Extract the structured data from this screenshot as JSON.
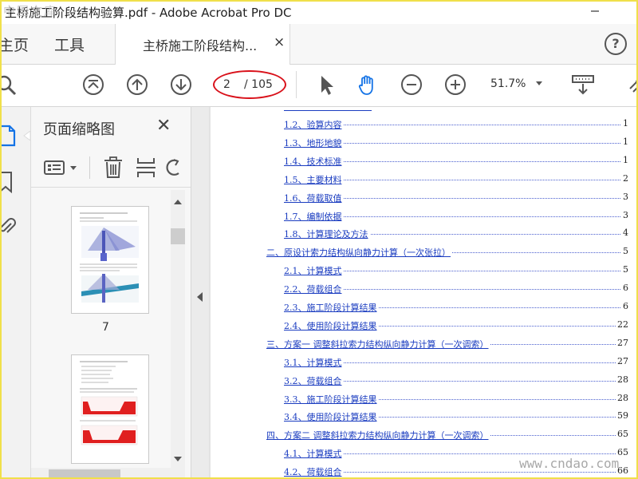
{
  "window": {
    "title": "主桥施工阶段结构验算.pdf - Adobe Acrobat Pro DC",
    "watermark_top": "中国文库"
  },
  "tabs": {
    "home": "主页",
    "tools": "工具",
    "document": "主桥施工阶段结构...",
    "close": "×",
    "help": "?"
  },
  "toolbar": {
    "current_page": "2",
    "total_pages": "/ 105",
    "zoom": "51.7%"
  },
  "thumbnail_panel": {
    "title": "页面缩略图",
    "close": "✕",
    "visible_thumb_label": "7"
  },
  "toc": [
    {
      "label": "1.2、验算内容",
      "page": "1",
      "level": 2
    },
    {
      "label": "1.3、地形地貌",
      "page": "1",
      "level": 2
    },
    {
      "label": "1.4、技术标准",
      "page": "1",
      "level": 2
    },
    {
      "label": "1.5、主要材料",
      "page": "2",
      "level": 2
    },
    {
      "label": "1.6、荷载取值",
      "page": "3",
      "level": 2
    },
    {
      "label": "1.7、编制依据",
      "page": "3",
      "level": 2
    },
    {
      "label": "1.8、计算理论及方法",
      "page": "4",
      "level": 2
    },
    {
      "label": "二、原设计索力结构纵向静力计算（一次张拉）",
      "page": "5",
      "level": 1
    },
    {
      "label": "2.1、计算模式",
      "page": "5",
      "level": 2
    },
    {
      "label": "2.2、荷载组合",
      "page": "6",
      "level": 2
    },
    {
      "label": "2.3、施工阶段计算结果",
      "page": "6",
      "level": 2
    },
    {
      "label": "2.4、使用阶段计算结果",
      "page": "22",
      "level": 2
    },
    {
      "label": "三、方案一 调整斜拉索力结构纵向静力计算（一次调索）",
      "page": "27",
      "level": 1
    },
    {
      "label": "3.1、计算模式",
      "page": "27",
      "level": 2
    },
    {
      "label": "3.2、荷载组合",
      "page": "28",
      "level": 2
    },
    {
      "label": "3.3、施工阶段计算结果",
      "page": "28",
      "level": 2
    },
    {
      "label": "3.4、使用阶段计算结果",
      "page": "59",
      "level": 2
    },
    {
      "label": "四、方案二 调整斜拉索力结构纵向静力计算（一次调索）",
      "page": "65",
      "level": 1
    },
    {
      "label": "4.1、计算模式",
      "page": "65",
      "level": 2
    },
    {
      "label": "4.2、荷载组合",
      "page": "66",
      "level": 2
    }
  ],
  "watermark_bottom": "www.cndao.com",
  "colors": {
    "link": "#1a3cc0",
    "highlight_ring": "#d9111a",
    "hand_tool": "#1473e6",
    "frame": "#f0e04a"
  }
}
